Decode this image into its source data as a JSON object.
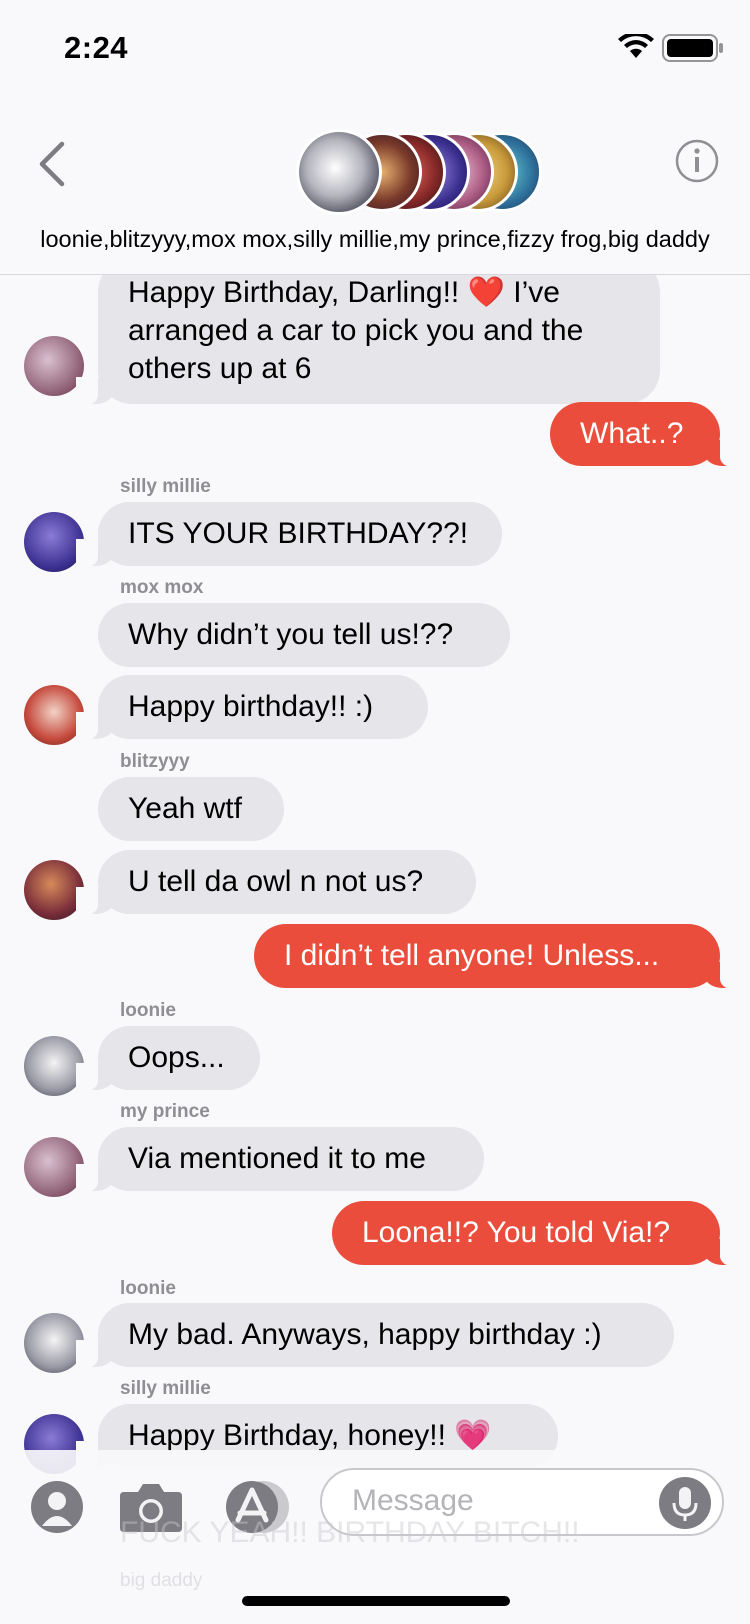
{
  "status": {
    "time": "2:24"
  },
  "header": {
    "group_names": "loonie,blitzyyy,mox mox,silly millie,my prince,fizzy frog,big daddy"
  },
  "messages": [
    {
      "type": "in",
      "text": "Happy Birthday, Darling!! ❤️ I’ve arranged a car to pick you and the others up at 6"
    },
    {
      "type": "out",
      "text": "What..?"
    },
    {
      "type": "in",
      "sender": "silly millie",
      "text": "ITS YOUR BIRTHDAY??!"
    },
    {
      "type": "in",
      "sender": "mox mox",
      "text": "Why didn’t you tell us!??"
    },
    {
      "type": "in",
      "text": "Happy birthday!! :)"
    },
    {
      "type": "in",
      "sender": "blitzyyy",
      "text": "Yeah wtf"
    },
    {
      "type": "in",
      "text": "U tell da owl n not us?"
    },
    {
      "type": "out",
      "text": "I didn’t tell anyone! Unless..."
    },
    {
      "type": "in",
      "sender": "loonie",
      "text": "Oops..."
    },
    {
      "type": "in",
      "sender": "my prince",
      "text": "Via mentioned it to me"
    },
    {
      "type": "out",
      "text": "Loona!!? You told Via!?"
    },
    {
      "type": "in",
      "sender": "loonie",
      "text": "My bad. Anyways, happy birthday :)"
    },
    {
      "type": "in",
      "sender": "silly millie",
      "text": "Happy Birthday, honey!! 💗"
    },
    {
      "type": "in",
      "text": "FUCK YEAH!! BIRTHDAY BITCH!!",
      "faded": true
    },
    {
      "type": "in",
      "sender": "big daddy",
      "faded": true
    }
  ],
  "composer": {
    "placeholder": "Message"
  },
  "icons": [
    "back-chevron-icon",
    "info-icon",
    "wifi-icon",
    "battery-icon",
    "contact-icon",
    "camera-icon",
    "app-store-icon",
    "microphone-icon"
  ],
  "colors": {
    "outgoing_bubble": "#eb4d3d",
    "incoming_bubble": "#e5e5ea"
  }
}
